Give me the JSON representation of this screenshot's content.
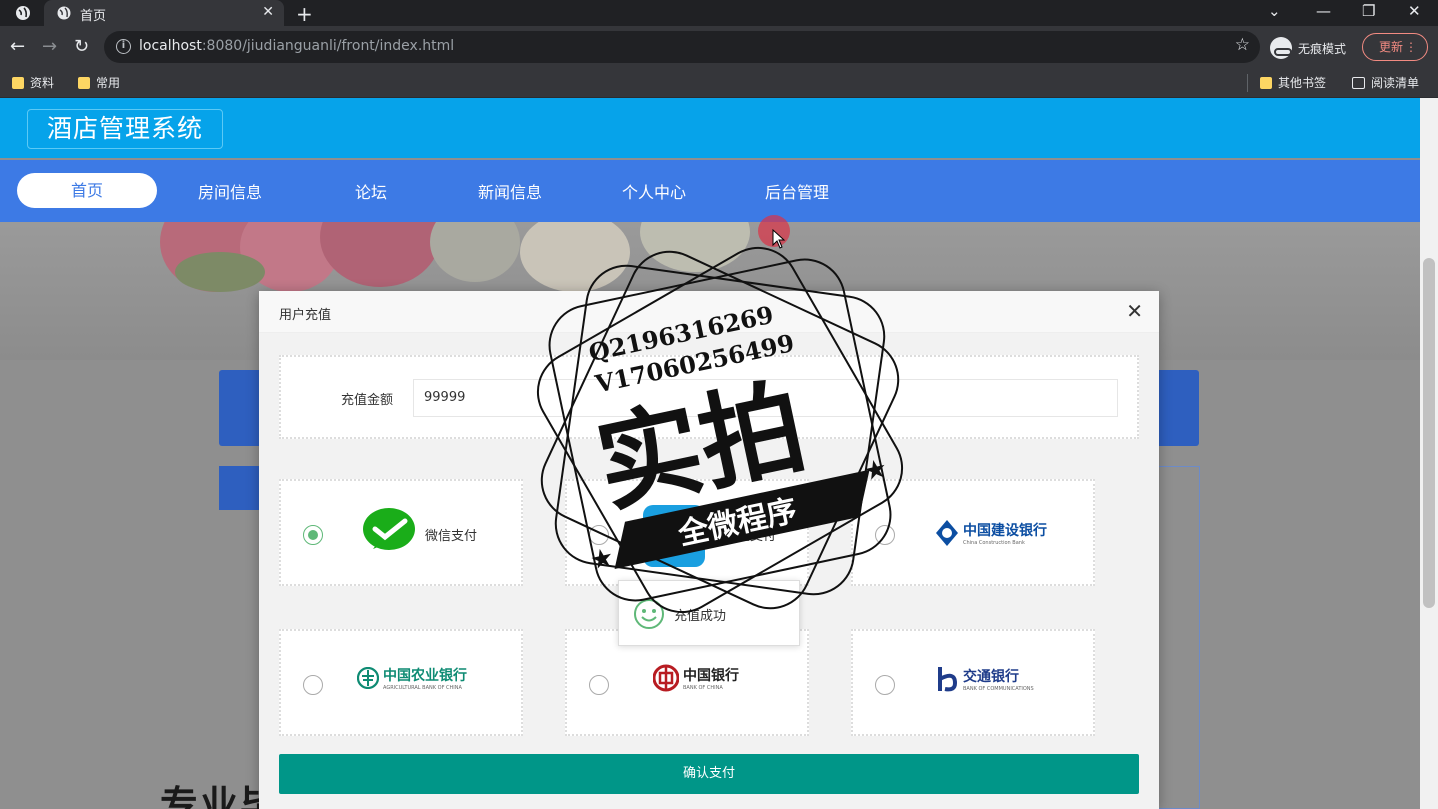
{
  "browser": {
    "tab_title": "首页",
    "url_host": "localhost",
    "url_path": ":8080/jiudianguanli/front/index.html",
    "incognito_label": "无痕模式",
    "update_label": "更新",
    "bookmarks": [
      "资料",
      "常用",
      "其他书签",
      "阅读清单"
    ]
  },
  "site": {
    "logo": "酒店管理系统",
    "nav": [
      "首页",
      "房间信息",
      "论坛",
      "新闻信息",
      "个人中心",
      "后台管理"
    ],
    "bottom_text": "专业毕设代做",
    "accent": "#3d7ae5",
    "header_color": "#06a3ea"
  },
  "modal": {
    "title": "用户充值",
    "amount_label": "充值金额",
    "amount_value": "99999",
    "payment_methods": [
      {
        "label": "微信支付",
        "selected": true
      },
      {
        "label": "支付宝支付",
        "selected": false
      },
      {
        "label": "中国建设银行",
        "sub": "China Construction Bank",
        "selected": false
      },
      {
        "label": "中国农业银行",
        "sub": "AGRICULTURAL BANK OF CHINA",
        "selected": false
      },
      {
        "label": "中国银行",
        "sub": "BANK OF CHINA",
        "selected": false
      },
      {
        "label": "交通银行",
        "sub": "BANK OF COMMUNICATIONS",
        "selected": false
      }
    ],
    "toast": "充值成功",
    "confirm_label": "确认支付",
    "confirm_color": "#009688"
  },
  "watermark": {
    "line1": "Q2196316269",
    "line2": "V17060256499",
    "main": "实拍",
    "ribbon": "全微程序"
  }
}
